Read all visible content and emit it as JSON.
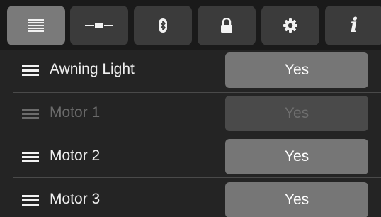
{
  "tabs": [
    {
      "name": "list",
      "icon": "list-icon",
      "active": true
    },
    {
      "name": "slider",
      "icon": "slider-icon",
      "active": false
    },
    {
      "name": "bluetooth",
      "icon": "bluetooth-icon",
      "active": false
    },
    {
      "name": "lock",
      "icon": "lock-icon",
      "active": false
    },
    {
      "name": "settings",
      "icon": "gear-icon",
      "active": false
    },
    {
      "name": "info",
      "icon": "info-icon",
      "glyph": "i",
      "active": false
    }
  ],
  "rows": [
    {
      "label": "Awning Light",
      "value": "Yes",
      "enabled": true
    },
    {
      "label": "Motor 1",
      "value": "Yes",
      "enabled": false
    },
    {
      "label": "Motor 2",
      "value": "Yes",
      "enabled": true
    },
    {
      "label": "Motor 3",
      "value": "Yes",
      "enabled": true
    }
  ],
  "colors": {
    "background": "#1f1f1f",
    "tab_active": "#7a7a7a",
    "tab_inactive": "#3b3b3b",
    "button": "#767676",
    "button_disabled": "#4a4a4a",
    "text": "#f0f0f0",
    "text_disabled": "#6b6b6b"
  }
}
